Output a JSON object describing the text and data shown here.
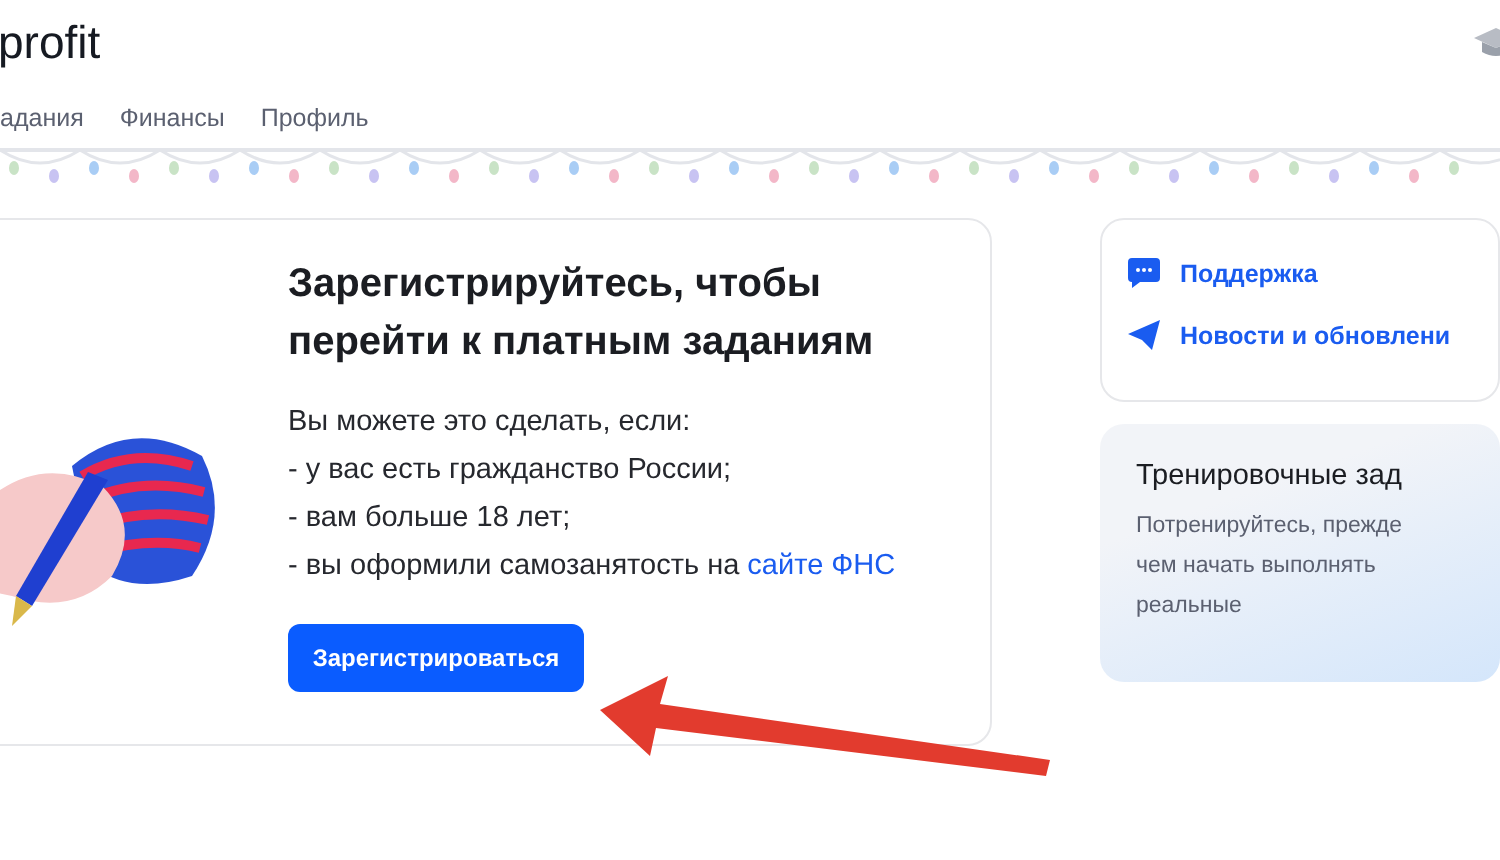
{
  "header": {
    "logo": "profit"
  },
  "nav": [
    {
      "label": "адания",
      "selected": false
    },
    {
      "label": "Финансы",
      "selected": false
    },
    {
      "label": "Профиль",
      "selected": false
    }
  ],
  "register_card": {
    "title": "Зарегистрируйтесь, чтобы перейти к платным заданиям",
    "intro": "Вы можете это сделать, если:",
    "conditions": [
      "- у вас есть гражданство России;",
      "- вам больше 18 лет;"
    ],
    "last_condition": "- вы оформили самозанятость на ",
    "link": "сайте ФНС",
    "button": "Зарегистрироваться"
  },
  "links": [
    {
      "kind": "chat",
      "label": "Поддержка"
    },
    {
      "kind": "telegram",
      "label": "Новости и обновлени"
    }
  ],
  "training_card": {
    "title": "Тренировочные зад",
    "text": [
      "Потренируйтесь, прежде",
      "чем начать выполнять",
      "реальные"
    ]
  }
}
